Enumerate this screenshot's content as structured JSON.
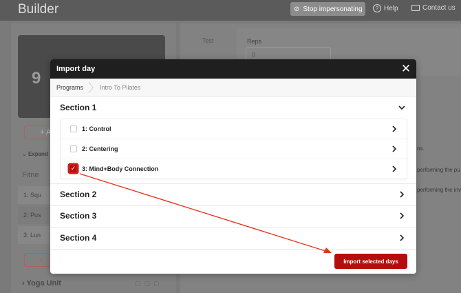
{
  "header": {
    "app_title": "Builder",
    "stop_impersonating": "Stop impersonating",
    "help": "Help",
    "contact": "Contact us"
  },
  "background": {
    "image_text": "9",
    "add_label": "+ A",
    "expand_label": "Expand",
    "fitness_label": "Fitne",
    "rows": [
      "1: Squ",
      "2: Pus",
      "3: Lun"
    ],
    "add_plus": "+",
    "yoga_unit": "Yoga Unit",
    "test_label": "Test",
    "reps_label": "Reps",
    "reps_value": "0",
    "snippets": [
      "ns.",
      "performing the pu",
      "performing the inv"
    ]
  },
  "modal": {
    "title": "Import day",
    "breadcrumb": {
      "home": "Programs",
      "current": "Intro To Pilates"
    },
    "sections": [
      {
        "label": "Section 1",
        "expanded": true,
        "days": [
          {
            "label": "1: Control",
            "checked": false
          },
          {
            "label": "2: Centering",
            "checked": false
          },
          {
            "label": "3: Mind+Body Connection",
            "checked": true
          }
        ]
      },
      {
        "label": "Section 2",
        "expanded": false
      },
      {
        "label": "Section 3",
        "expanded": false
      },
      {
        "label": "Section 4",
        "expanded": false
      }
    ],
    "import_button": "Import selected days"
  },
  "colors": {
    "accent": "#b50d0d",
    "annotation_arrow": "#e8321e",
    "modal_header": "#1f1f1f"
  }
}
